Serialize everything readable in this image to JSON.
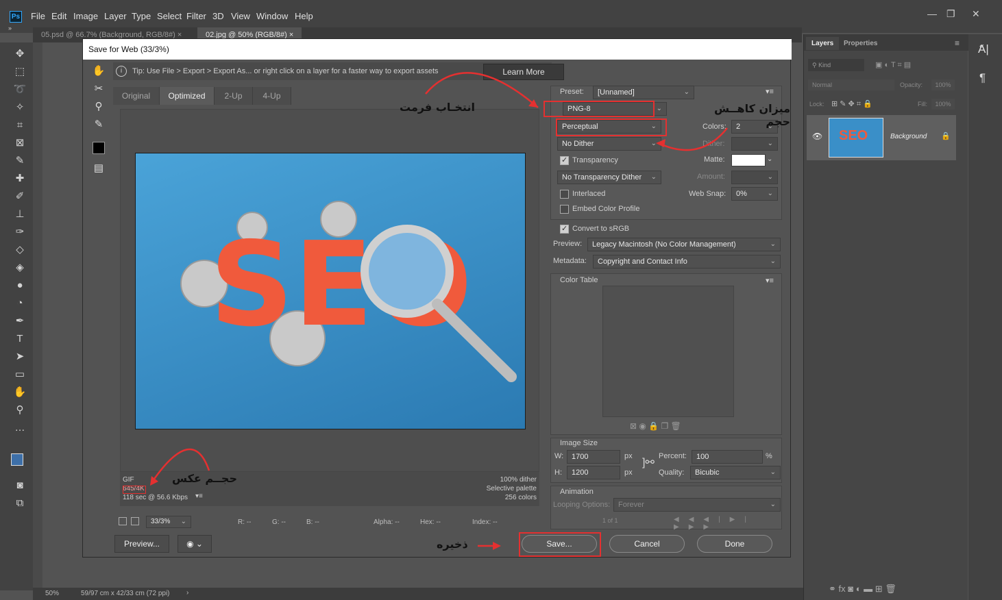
{
  "menubar": {
    "logo": "Ps",
    "items": [
      "File",
      "Edit",
      "Image",
      "Layer",
      "Type",
      "Select",
      "Filter",
      "3D",
      "View",
      "Window",
      "Help"
    ]
  },
  "doc_tabs": [
    {
      "label": "05.psd @ 66.7% (Background, RGB/8#)",
      "close": "×"
    },
    {
      "label": "02.jpg @ 50% (RGB/8#)",
      "close": "×"
    }
  ],
  "dialog": {
    "title": "Save for Web (33/3%)",
    "tip": "Tip: Use File > Export > Export As...  or right click on a layer for a faster way to export assets",
    "learn_more": "Learn More",
    "view_tabs": [
      "Original",
      "Optimized",
      "2-Up",
      "4-Up"
    ],
    "info_left": {
      "format": "GIF",
      "size": "645/4K",
      "time": "118 sec @ 56.6 Kbps"
    },
    "info_right": {
      "dither": "100% dither",
      "palette": "Selective palette",
      "colors": "256 colors"
    },
    "zoom": {
      "value": "33/3%",
      "r": "R: --",
      "g": "G: --",
      "b": "B: --",
      "alpha": "Alpha: --",
      "hex": "Hex: --",
      "index": "Index: --"
    },
    "preview_button": "Preview...",
    "save_button": "Save...",
    "cancel_button": "Cancel",
    "done_button": "Done",
    "settings": {
      "preset_label": "Preset:",
      "preset_value": "[Unnamed]",
      "format": "PNG-8",
      "reduction": "Perceptual",
      "dither": "No Dither",
      "colors_label": "Colors:",
      "colors_value": "2",
      "dither_label": "Dither:",
      "transparency": "Transparency",
      "matte_label": "Matte:",
      "transparency_dither": "No Transparency Dither",
      "amount_label": "Amount:",
      "interlaced": "Interlaced",
      "web_snap_label": "Web Snap:",
      "web_snap_value": "0%",
      "embed_profile": "Embed Color Profile",
      "convert_srgb": "Convert to sRGB",
      "preview_label": "Preview:",
      "preview_value": "Legacy Macintosh (No Color Management)",
      "metadata_label": "Metadata:",
      "metadata_value": "Copyright and Contact Info",
      "color_table": "Color Table",
      "image_size": "Image Size",
      "w_label": "W:",
      "w_value": "1700",
      "h_label": "H:",
      "h_value": "1200",
      "px": "px",
      "percent_label": "Percent:",
      "percent_value": "100",
      "percent_unit": "%",
      "quality_label": "Quality:",
      "quality_value": "Bicubic",
      "animation": "Animation",
      "looping_label": "Looping Options:",
      "looping_value": "Forever",
      "frame_counter": "1 of 1"
    },
    "image_text": "SEO"
  },
  "annotations": {
    "format": "انتخـاب فرمت",
    "reduction": "میزان کاهــش حجم",
    "size": "حجــم عکس",
    "save": "ذخیره"
  },
  "layers_panel": {
    "tabs": [
      "Layers",
      "Properties"
    ],
    "kind": "Kind",
    "blend": "Normal",
    "opacity_label": "Opacity:",
    "opacity_value": "100%",
    "lock_label": "Lock:",
    "fill_label": "Fill:",
    "fill_value": "100%",
    "layer_name": "Background"
  },
  "statusbar": {
    "zoom": "50%",
    "doc_size": "59/97 cm x 42/33 cm (72 ppi)"
  },
  "colors": {
    "accent_red": "#e53030",
    "image_blue": "#3a8fc8",
    "seo_orange": "#f05a3c"
  }
}
